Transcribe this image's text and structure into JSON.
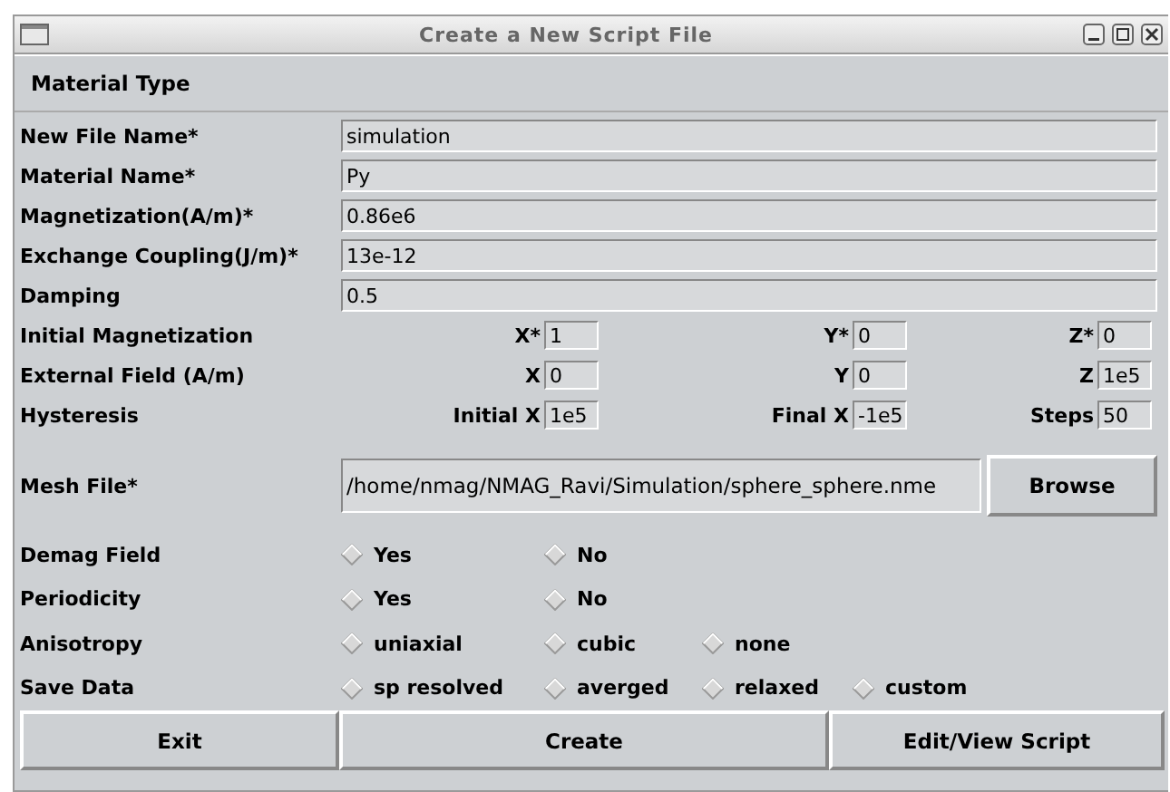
{
  "window": {
    "title": "Create a New Script File"
  },
  "section": {
    "title": "Material Type"
  },
  "rows": [
    {
      "kind": "text",
      "label": "New File Name*",
      "value": "simulation"
    },
    {
      "kind": "text",
      "label": "Material Name*",
      "value": "Py"
    },
    {
      "kind": "text",
      "label": "Magnetization(A/m)*",
      "value": "0.86e6"
    },
    {
      "kind": "text",
      "label": "Exchange Coupling(J/m)*",
      "value": "13e-12"
    },
    {
      "kind": "text",
      "label": "Damping",
      "value": "0.5"
    },
    {
      "kind": "triple",
      "label": "Initial Magnetization",
      "fields": [
        {
          "label": "X*",
          "value": "1"
        },
        {
          "label": "Y*",
          "value": "0"
        },
        {
          "label": "Z*",
          "value": "0"
        }
      ]
    },
    {
      "kind": "triple",
      "label": "External Field (A/m)",
      "fields": [
        {
          "label": "X",
          "value": "0"
        },
        {
          "label": "Y",
          "value": "0"
        },
        {
          "label": "Z",
          "value": "1e5"
        }
      ]
    },
    {
      "kind": "triple",
      "label": "Hysteresis",
      "fields": [
        {
          "label": "Initial X",
          "value": "1e5"
        },
        {
          "label": "Final X",
          "value": "-1e5"
        },
        {
          "label": "Steps",
          "value": "50"
        }
      ]
    },
    {
      "kind": "file",
      "label": "Mesh File*",
      "value": "/home/nmag/NMAG_Ravi/Simulation/sphere_sphere.nme",
      "button": "Browse"
    },
    {
      "kind": "radio",
      "label": "Demag Field",
      "options": [
        {
          "label": "Yes",
          "selected": false
        },
        {
          "label": "No",
          "selected": false
        }
      ]
    },
    {
      "kind": "radio",
      "label": "Periodicity",
      "options": [
        {
          "label": "Yes",
          "selected": false
        },
        {
          "label": "No",
          "selected": false
        }
      ]
    },
    {
      "kind": "radio",
      "label": "Anisotropy",
      "options": [
        {
          "label": "uniaxial",
          "selected": false
        },
        {
          "label": "cubic",
          "selected": false
        },
        {
          "label": "none",
          "selected": false
        }
      ]
    },
    {
      "kind": "radio",
      "label": "Save Data",
      "options": [
        {
          "label": "sp resolved",
          "selected": false
        },
        {
          "label": "averged",
          "selected": false
        },
        {
          "label": "relaxed",
          "selected": false
        },
        {
          "label": "custom",
          "selected": false
        }
      ]
    }
  ],
  "buttons": [
    "Exit",
    "Create",
    "Edit/View Script"
  ]
}
